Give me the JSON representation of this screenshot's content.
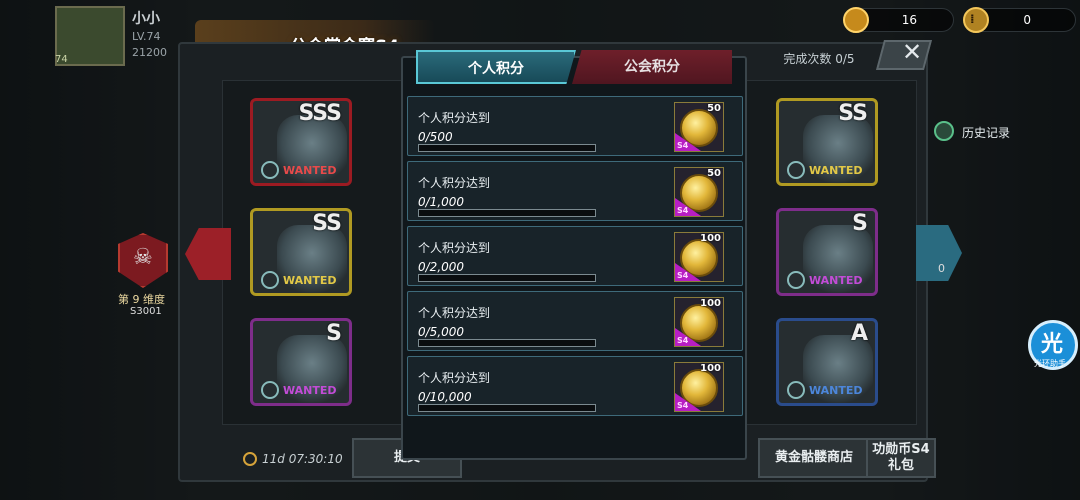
{
  "header": {
    "player_name": "小小",
    "player_level": "LV.74",
    "player_points": "21200",
    "avatar_level": "74",
    "event_title": "公会赏金赛S4",
    "resource_1": "16",
    "resource_2": "0"
  },
  "board": {
    "completion_text": "完成次数 0/5",
    "history_label": "历史记录",
    "rank_label": "第 9 维度",
    "rank_server": "S3001",
    "right_count": "0",
    "timer": "11d 07:30:10",
    "submit_label": "提交",
    "shop_label": "黄金骷髅商店",
    "gift_label": "功勋币S4礼包",
    "helper_label": "光环助手",
    "helper_glyph": "光",
    "cards": [
      {
        "rank": "SSS",
        "status": "WANTED",
        "color": "red"
      },
      {
        "rank": "SS",
        "status": "WANTED",
        "color": "gold"
      },
      {
        "rank": "SS",
        "status": "WANTED",
        "color": "gold"
      },
      {
        "rank": "S",
        "status": "WANTED",
        "color": "purple"
      },
      {
        "rank": "S",
        "status": "WANTED",
        "color": "purple"
      },
      {
        "rank": "A",
        "status": "WANTED",
        "color": "blue"
      }
    ]
  },
  "modal": {
    "tab_personal": "个人积分",
    "tab_guild": "公会积分",
    "tasks": [
      {
        "label": "个人积分达到",
        "current": "0",
        "target": "/500",
        "reward_qty": "50",
        "reward_tag": "S4",
        "progress": 0
      },
      {
        "label": "个人积分达到",
        "current": "0",
        "target": "/1,000",
        "reward_qty": "50",
        "reward_tag": "S4",
        "progress": 0
      },
      {
        "label": "个人积分达到",
        "current": "0",
        "target": "/2,000",
        "reward_qty": "100",
        "reward_tag": "S4",
        "progress": 0
      },
      {
        "label": "个人积分达到",
        "current": "0",
        "target": "/5,000",
        "reward_qty": "100",
        "reward_tag": "S4",
        "progress": 0
      },
      {
        "label": "个人积分达到",
        "current": "0",
        "target": "/10,000",
        "reward_qty": "100",
        "reward_tag": "S4",
        "progress": 0
      }
    ]
  },
  "colors": {
    "tab_active": "#2a6a7a",
    "tab_inactive": "#6e1f2a",
    "progress_fill": "#6cc3d8",
    "reward_corner": "#b81ec4"
  },
  "icons": {
    "resource_1": "panda-coin-icon",
    "resource_2": "medal-coin-icon",
    "close": "close-icon",
    "history": "clock-icon",
    "timer": "stopwatch-icon",
    "rank": "skull-icon",
    "reward": "gold-medal-icon"
  }
}
